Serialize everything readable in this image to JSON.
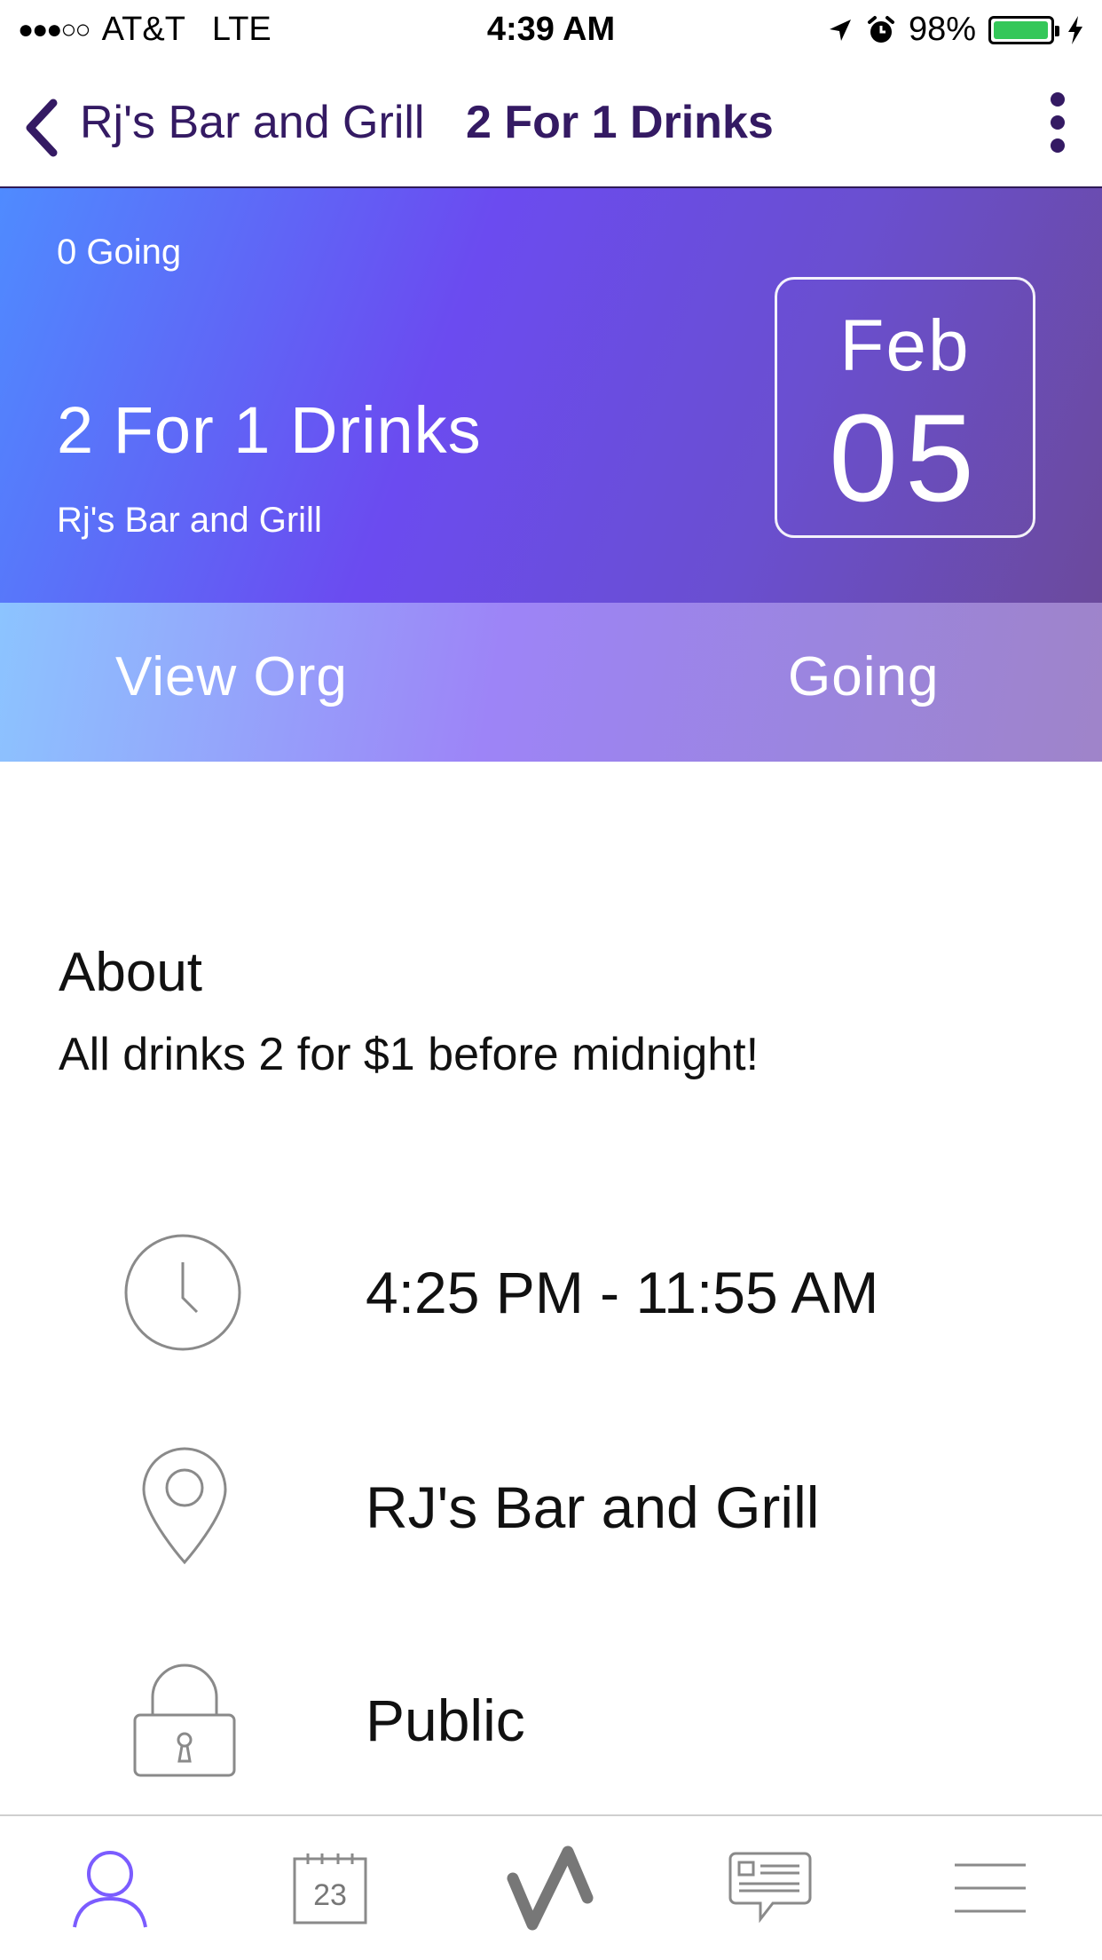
{
  "status_bar": {
    "signal": "●●●○○",
    "carrier": "AT&T",
    "network": "LTE",
    "time": "4:39 AM",
    "battery_percent": "98%",
    "battery_level": 0.98
  },
  "nav": {
    "back_label": "Rj's Bar and Grill",
    "title": "2 For 1 Drinks"
  },
  "hero": {
    "going_count": "0 Going",
    "event_title": "2 For 1 Drinks",
    "org_name": "Rj's Bar and Grill",
    "date_month": "Feb",
    "date_day": "05"
  },
  "actions": {
    "view_org": "View Org",
    "going": "Going"
  },
  "about": {
    "heading": "About",
    "text": "All drinks 2 for $1 before midnight!"
  },
  "details": {
    "time": "4:25 PM - 11:55 AM",
    "location": "RJ's Bar and Grill",
    "privacy": "Public"
  },
  "tab_bar": {
    "calendar_day": "23",
    "active_tab": "profile"
  },
  "colors": {
    "nav_text": "#341a63",
    "active_tab": "#7b5cff",
    "inactive_tab": "#8a8a8a",
    "hero_gradient_start": "#4f8bff",
    "hero_gradient_end": "#6b4a9c"
  },
  "icons": {
    "back": "chevron-left-icon",
    "more": "more-vertical-icon",
    "clock": "clock-icon",
    "location": "map-pin-icon",
    "privacy": "lock-icon",
    "tab_profile": "user-icon",
    "tab_calendar": "calendar-icon",
    "tab_feed": "activity-icon",
    "tab_messages": "message-icon",
    "tab_menu": "menu-icon",
    "signal": "location-arrow-icon",
    "alarm": "alarm-icon",
    "charging": "bolt-icon"
  }
}
